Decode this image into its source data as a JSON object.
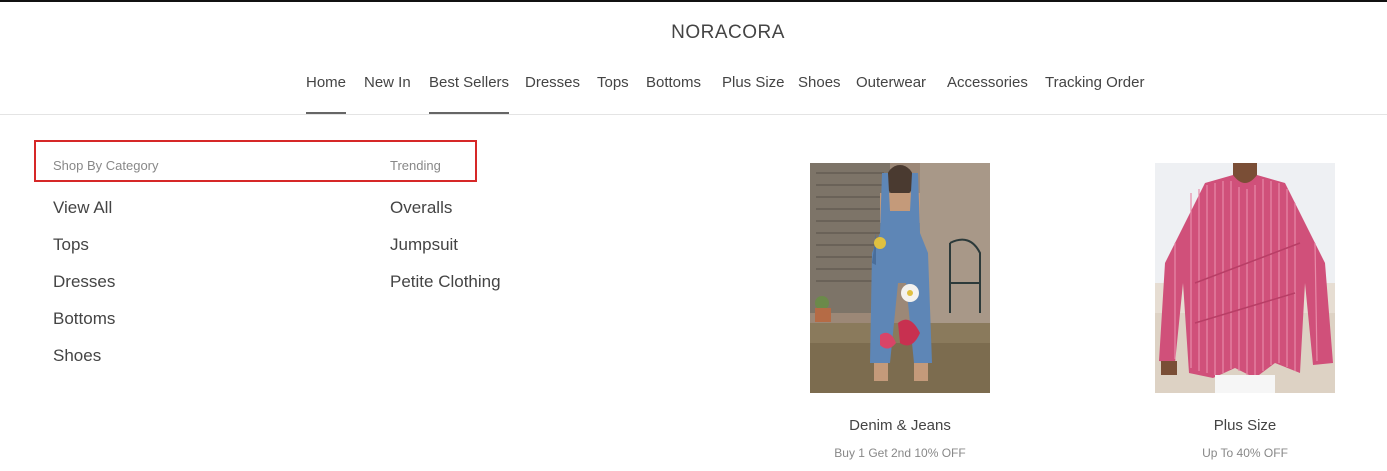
{
  "header": {
    "brand": "NORACORA"
  },
  "nav": {
    "items": [
      {
        "label": "Home"
      },
      {
        "label": "New In"
      },
      {
        "label": "Best Sellers"
      },
      {
        "label": "Dresses"
      },
      {
        "label": "Tops"
      },
      {
        "label": "Bottoms"
      },
      {
        "label": "Plus Size"
      },
      {
        "label": "Shoes"
      },
      {
        "label": "Outerwear"
      },
      {
        "label": "Accessories"
      },
      {
        "label": "Tracking Order"
      }
    ]
  },
  "menu": {
    "category_heading": "Shop By Category",
    "trending_heading": "Trending",
    "categories": [
      {
        "label": "View All"
      },
      {
        "label": "Tops"
      },
      {
        "label": "Dresses"
      },
      {
        "label": "Bottoms"
      },
      {
        "label": "Shoes"
      }
    ],
    "trending": [
      {
        "label": "Overalls"
      },
      {
        "label": "Jumpsuit"
      },
      {
        "label": "Petite Clothing"
      }
    ]
  },
  "promos": [
    {
      "title": "Denim & Jeans",
      "subtitle": "Buy 1 Get 2nd 10% OFF"
    },
    {
      "title": "Plus Size",
      "subtitle": "Up To 40% OFF"
    }
  ],
  "colors": {
    "highlight": "#d62828",
    "active_underline": "#666666"
  }
}
